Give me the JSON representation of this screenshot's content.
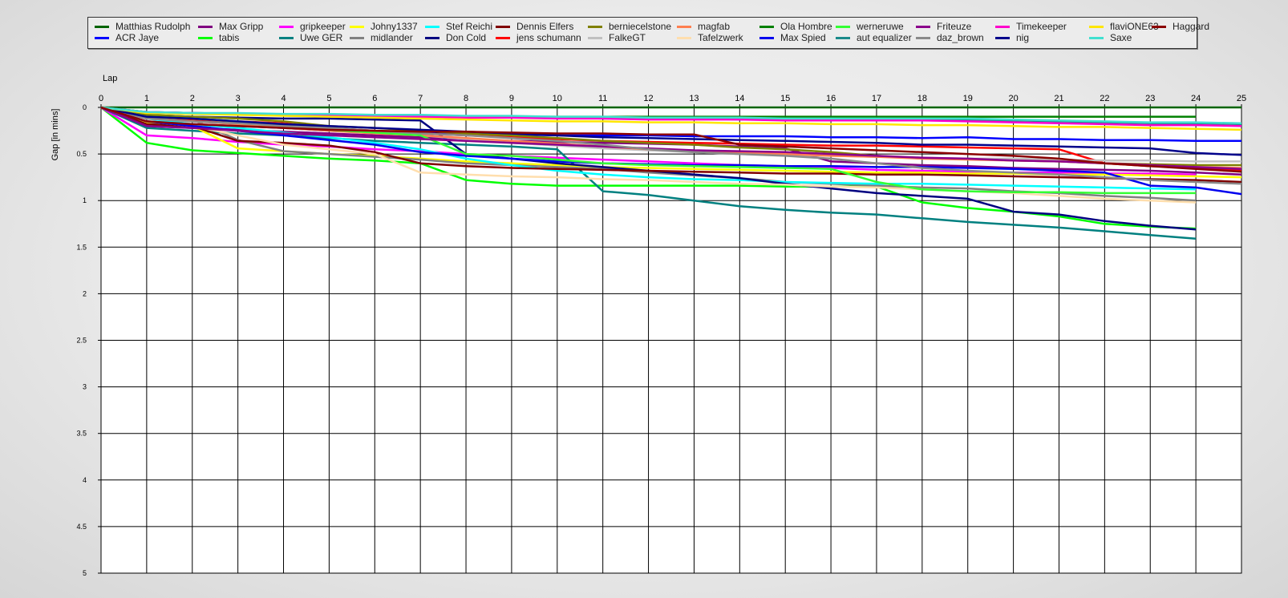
{
  "chart_data": {
    "type": "line",
    "xlabel": "Lap",
    "ylabel": "Gap [in mins]",
    "xlim": [
      0,
      25
    ],
    "ylim": [
      0,
      5
    ],
    "y_inverted": true,
    "grid": true,
    "legend_position": "top",
    "x_ticks": [
      "0",
      "1",
      "2",
      "3",
      "4",
      "5",
      "6",
      "7",
      "8",
      "9",
      "10",
      "11",
      "12",
      "13",
      "14",
      "15",
      "16",
      "17",
      "18",
      "19",
      "20",
      "21",
      "22",
      "23",
      "24",
      "25"
    ],
    "y_ticks": [
      "0",
      "0.5",
      "1",
      "1.5",
      "2",
      "2.5",
      "3",
      "3.5",
      "4",
      "4.5",
      "5"
    ],
    "x": [
      0,
      1,
      2,
      3,
      4,
      5,
      6,
      7,
      8,
      9,
      10,
      11,
      12,
      13,
      14,
      15,
      16,
      17,
      18,
      19,
      20,
      21,
      22,
      23,
      24,
      25
    ],
    "series": [
      {
        "name": "Matthias  Rudolph",
        "color": "#006400",
        "values": [
          0,
          0,
          0,
          0,
          0,
          0,
          0,
          0,
          0,
          0,
          0,
          0,
          0,
          0,
          0,
          0,
          0,
          0,
          0,
          0,
          0,
          0,
          0,
          0,
          0,
          0
        ]
      },
      {
        "name": "ACR Jaye",
        "color": "#0000ff",
        "values": [
          0,
          0.15,
          0.18,
          0.2,
          0.22,
          0.25,
          0.27,
          0.28,
          0.28,
          0.29,
          0.3,
          0.3,
          0.3,
          0.31,
          0.31,
          0.31,
          0.32,
          0.32,
          0.33,
          0.32,
          0.34,
          0.34,
          0.35,
          0.35,
          0.36,
          0.36
        ]
      },
      {
        "name": "Max Gripp",
        "color": "#800080",
        "values": [
          0,
          0.2,
          0.22,
          0.24,
          0.26,
          0.28,
          0.3,
          0.32,
          0.34,
          0.36,
          0.37,
          0.38,
          0.39,
          0.4,
          0.42,
          0.44,
          0.58,
          0.6,
          0.62,
          0.63,
          0.65,
          0.66,
          0.67,
          0.68,
          0.7,
          0.72
        ]
      },
      {
        "name": "tabis",
        "color": "#00ff00",
        "values": [
          0,
          0.38,
          0.46,
          0.49,
          0.52,
          0.55,
          0.57,
          0.6,
          0.78,
          0.82,
          0.84,
          0.84,
          0.84,
          0.84,
          0.84,
          0.85,
          0.85,
          0.85,
          1.02,
          1.08,
          1.12,
          1.17,
          1.25,
          1.28,
          1.3,
          null
        ]
      },
      {
        "name": "gripkeeper",
        "color": "#ff00ff",
        "values": [
          0,
          0.3,
          0.33,
          0.37,
          0.4,
          0.42,
          0.45,
          0.47,
          0.5,
          0.52,
          0.54,
          0.56,
          0.58,
          0.6,
          0.62,
          0.63,
          0.65,
          0.67,
          0.68,
          0.69,
          0.7,
          0.7,
          0.71,
          0.71,
          0.72,
          null
        ]
      },
      {
        "name": "Uwe GER",
        "color": "#008080",
        "values": [
          0,
          0.22,
          0.25,
          0.28,
          0.3,
          0.33,
          0.36,
          0.38,
          0.4,
          0.42,
          0.45,
          0.9,
          0.94,
          1.0,
          1.06,
          1.1,
          1.13,
          1.15,
          1.19,
          1.23,
          1.26,
          1.29,
          1.33,
          1.37,
          1.41,
          null
        ]
      },
      {
        "name": "Johny1337",
        "color": "#ffff00",
        "values": [
          0,
          0.17,
          0.2,
          0.44,
          0.47,
          0.5,
          0.52,
          0.55,
          0.58,
          0.6,
          0.62,
          0.64,
          0.65,
          0.66,
          0.67,
          0.68,
          0.69,
          0.7,
          0.7,
          0.71,
          0.71,
          0.72,
          0.72,
          0.73,
          0.74,
          0.75
        ]
      },
      {
        "name": "midlander",
        "color": "#808080",
        "values": [
          0,
          0.1,
          0.13,
          0.35,
          0.47,
          0.5,
          0.53,
          0.56,
          0.6,
          0.62,
          0.64,
          0.66,
          0.7,
          0.73,
          0.76,
          0.8,
          0.82,
          0.84,
          0.86,
          0.87,
          0.9,
          0.92,
          0.95,
          0.97,
          1.0,
          null
        ]
      },
      {
        "name": "Stef Reichi",
        "color": "#00ffff",
        "values": [
          0,
          0.12,
          0.18,
          0.22,
          0.27,
          0.32,
          0.38,
          0.45,
          0.55,
          0.62,
          0.68,
          0.72,
          0.75,
          0.77,
          0.78,
          0.8,
          0.81,
          0.82,
          0.82,
          0.83,
          0.84,
          0.85,
          0.86,
          0.87,
          0.88,
          null
        ]
      },
      {
        "name": "Don Cold",
        "color": "#000080",
        "values": [
          0,
          0.08,
          0.1,
          0.11,
          0.12,
          0.12,
          0.13,
          0.14,
          0.5,
          0.55,
          0.6,
          0.64,
          0.68,
          0.72,
          0.76,
          0.82,
          0.87,
          0.92,
          0.95,
          0.98,
          1.12,
          1.15,
          1.22,
          1.27,
          1.31,
          null
        ]
      },
      {
        "name": "Dennis Elfers",
        "color": "#800000",
        "values": [
          0,
          0.18,
          0.2,
          0.36,
          0.38,
          0.41,
          0.48,
          0.6,
          0.63,
          0.65,
          0.66,
          0.67,
          0.68,
          0.69,
          0.7,
          0.71,
          0.71,
          0.72,
          0.72,
          0.73,
          0.74,
          0.75,
          0.76,
          0.77,
          0.78,
          0.8
        ]
      },
      {
        "name": "jens  schumann",
        "color": "#ff0000",
        "values": [
          0,
          0.12,
          0.14,
          0.15,
          0.17,
          0.22,
          0.25,
          0.28,
          0.3,
          0.32,
          0.34,
          0.36,
          0.37,
          0.38,
          0.39,
          0.4,
          0.41,
          0.41,
          0.42,
          0.43,
          0.44,
          0.45,
          0.6,
          0.63,
          0.65,
          0.67
        ]
      },
      {
        "name": "berniecelstone",
        "color": "#808000",
        "values": [
          0,
          0.08,
          0.1,
          0.12,
          0.15,
          0.2,
          0.22,
          0.25,
          0.28,
          0.3,
          0.33,
          0.36,
          0.38,
          0.4,
          0.43,
          0.45,
          0.48,
          0.52,
          0.55,
          0.55,
          0.57,
          0.58,
          0.6,
          0.61,
          0.62,
          0.62
        ]
      },
      {
        "name": "FalkeGT",
        "color": "#c0c0c0",
        "values": [
          0,
          0.1,
          0.12,
          0.15,
          0.18,
          0.22,
          0.26,
          0.3,
          0.34,
          0.38,
          0.41,
          0.44,
          0.46,
          0.48,
          0.5,
          0.51,
          0.52,
          0.53,
          0.54,
          0.55,
          0.55,
          0.56,
          0.57,
          0.57,
          0.58,
          0.58
        ]
      },
      {
        "name": "magfab",
        "color": "#ff7f50",
        "values": [
          0,
          0.12,
          0.15,
          0.18,
          0.22,
          0.25,
          0.28,
          0.3,
          0.33,
          0.36,
          0.39,
          0.42,
          0.45,
          0.47,
          0.49,
          0.5,
          0.52,
          0.53,
          0.55,
          0.56,
          0.57,
          0.58,
          0.6,
          0.62,
          0.64,
          0.65
        ]
      },
      {
        "name": "Tafelzwerk",
        "color": "#ffdead",
        "values": [
          0,
          0.15,
          0.2,
          0.3,
          0.4,
          0.45,
          0.5,
          0.7,
          0.72,
          0.74,
          0.75,
          0.77,
          0.78,
          0.8,
          0.82,
          0.83,
          0.85,
          0.86,
          0.88,
          0.9,
          0.92,
          0.95,
          0.98,
          1.0,
          1.02,
          null
        ]
      },
      {
        "name": "Ola Hombre",
        "color": "#008000",
        "values": [
          0,
          0.05,
          0.06,
          0.07,
          0.08,
          0.08,
          0.09,
          0.1,
          0.1,
          0.1,
          0.1,
          0.1,
          0.1,
          0.1,
          0.1,
          0.1,
          0.1,
          0.1,
          0.1,
          0.1,
          0.1,
          0.1,
          0.1,
          0.1,
          0.1,
          null
        ]
      },
      {
        "name": "Max Spied",
        "color": "#0000ee",
        "values": [
          0,
          0.15,
          0.2,
          0.25,
          0.3,
          0.35,
          0.4,
          0.48,
          0.52,
          0.55,
          0.58,
          0.6,
          0.61,
          0.62,
          0.62,
          0.63,
          0.63,
          0.64,
          0.64,
          0.65,
          0.66,
          0.68,
          0.7,
          0.84,
          0.86,
          0.93
        ]
      },
      {
        "name": "werneruwe",
        "color": "#33ff33",
        "values": [
          0,
          0.1,
          0.12,
          0.15,
          0.2,
          0.24,
          0.27,
          0.3,
          0.5,
          0.52,
          0.56,
          0.6,
          0.62,
          0.63,
          0.64,
          0.65,
          0.66,
          0.8,
          0.88,
          0.9,
          0.91,
          0.91,
          0.92,
          0.92,
          0.92,
          null
        ]
      },
      {
        "name": "aut equalizer",
        "color": "#1a8a8a",
        "values": [
          0,
          0.05,
          0.06,
          0.07,
          0.08,
          0.08,
          0.09,
          0.1,
          0.1,
          0.11,
          0.11,
          0.12,
          0.12,
          0.12,
          0.13,
          0.13,
          0.14,
          0.14,
          0.14,
          0.14,
          0.14,
          0.15,
          0.16,
          0.17,
          0.17,
          0.18
        ]
      },
      {
        "name": "Friteuze",
        "color": "#8b008b",
        "values": [
          0,
          0.2,
          0.22,
          0.25,
          0.28,
          0.3,
          0.32,
          0.34,
          0.36,
          0.38,
          0.4,
          0.42,
          0.44,
          0.46,
          0.47,
          0.48,
          0.5,
          0.52,
          0.54,
          0.55,
          0.57,
          0.58,
          0.6,
          0.62,
          0.64,
          0.66
        ]
      },
      {
        "name": "daz_brown",
        "color": "#8a8a8a",
        "values": [
          0,
          0.12,
          0.15,
          0.17,
          0.2,
          0.22,
          0.25,
          0.28,
          0.3,
          0.33,
          0.36,
          0.4,
          0.45,
          0.48,
          0.5,
          0.52,
          0.55,
          0.6,
          0.65,
          0.68,
          0.7,
          0.72,
          0.75,
          0.78,
          0.8,
          0.82
        ]
      },
      {
        "name": "Timekeeper",
        "color": "#ff00cc",
        "values": [
          0,
          0.05,
          0.06,
          0.07,
          0.08,
          0.09,
          0.1,
          0.1,
          0.11,
          0.11,
          0.12,
          0.12,
          0.13,
          0.13,
          0.13,
          0.14,
          0.14,
          0.14,
          0.14,
          0.15,
          0.16,
          0.17,
          0.18,
          0.19,
          0.19,
          0.2
        ]
      },
      {
        "name": "nig",
        "color": "#00008b",
        "values": [
          0,
          0.1,
          0.12,
          0.15,
          0.18,
          0.2,
          0.22,
          0.24,
          0.26,
          0.28,
          0.3,
          0.32,
          0.33,
          0.34,
          0.35,
          0.36,
          0.37,
          0.38,
          0.4,
          0.4,
          0.41,
          0.42,
          0.43,
          0.44,
          0.49,
          0.51
        ]
      },
      {
        "name": "flaviONE63",
        "color": "#ffe600",
        "values": [
          0,
          0.06,
          0.07,
          0.08,
          0.09,
          0.1,
          0.11,
          0.12,
          0.13,
          0.14,
          0.15,
          0.15,
          0.16,
          0.16,
          0.17,
          0.17,
          0.18,
          0.18,
          0.19,
          0.19,
          0.2,
          0.21,
          0.21,
          0.22,
          0.23,
          0.24
        ]
      },
      {
        "name": "Saxe",
        "color": "#40e0d0",
        "values": [
          0,
          0.05,
          0.06,
          0.06,
          0.07,
          0.07,
          0.08,
          0.08,
          0.09,
          0.09,
          0.1,
          0.1,
          0.11,
          0.11,
          0.11,
          0.12,
          0.12,
          0.12,
          0.12,
          0.12,
          0.13,
          0.14,
          0.15,
          0.16,
          0.16,
          0.17
        ]
      },
      {
        "name": "Haggard",
        "color": "#8b0000",
        "values": [
          0,
          0.15,
          0.18,
          0.2,
          0.22,
          0.24,
          0.25,
          0.26,
          0.26,
          0.27,
          0.28,
          0.28,
          0.29,
          0.29,
          0.4,
          0.42,
          0.44,
          0.46,
          0.48,
          0.5,
          0.52,
          0.55,
          0.6,
          0.63,
          0.66,
          0.69
        ]
      }
    ]
  }
}
